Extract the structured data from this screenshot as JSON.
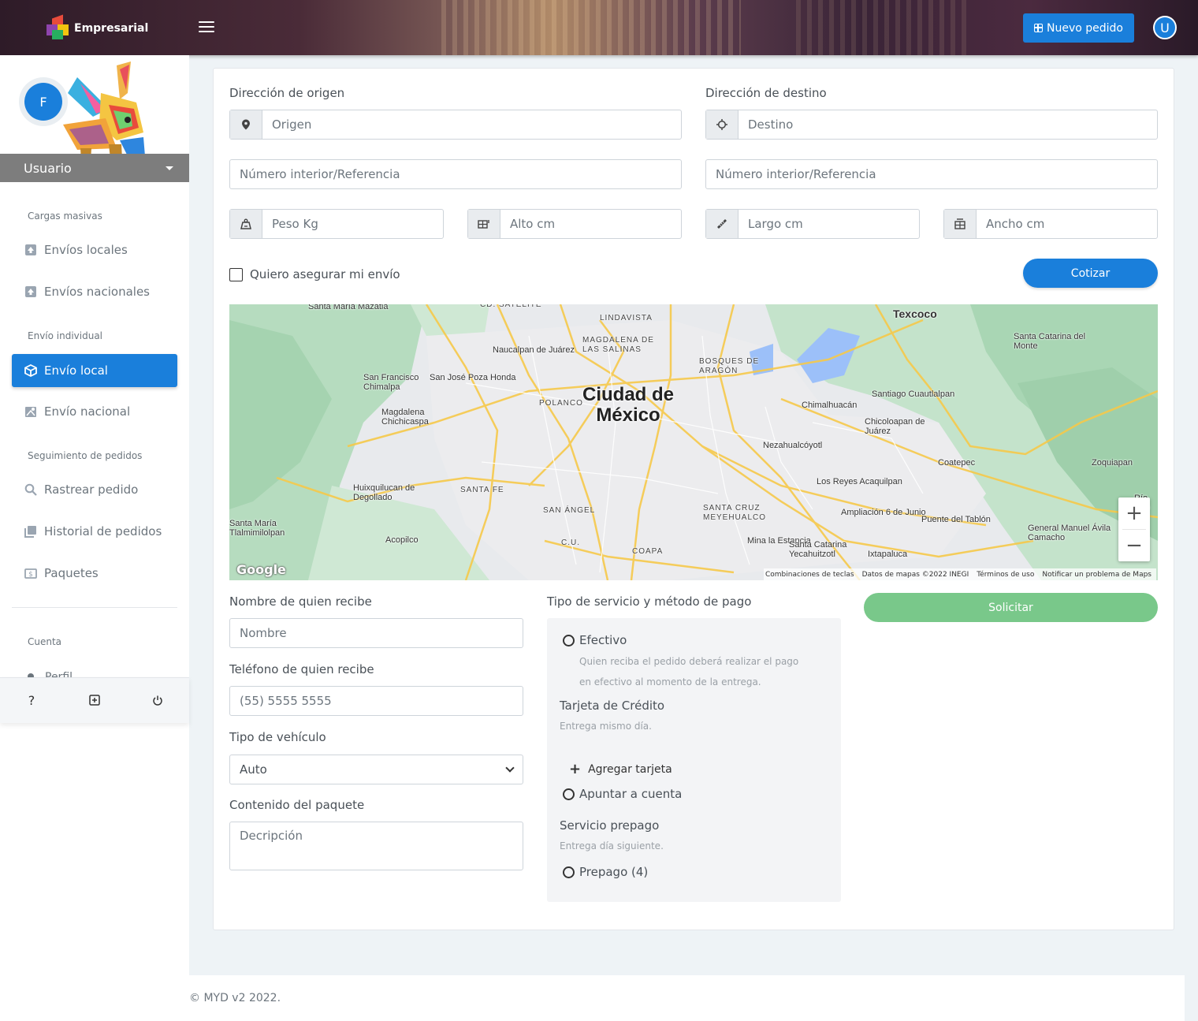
{
  "header": {
    "brand": "Empresarial",
    "new_order_label": "Nuevo pedido",
    "user_initial": "U"
  },
  "sidebar": {
    "avatar_initial": "F",
    "user_label": "Usuario",
    "sections": {
      "bulk": "Cargas masivas",
      "individual": "Envío individual",
      "tracking": "Seguimiento de pedidos",
      "account": "Cuenta"
    },
    "items": {
      "local_bulk": "Envíos locales",
      "national_bulk": "Envíos nacionales",
      "local": "Envío local",
      "national": "Envío nacional",
      "track": "Rastrear pedido",
      "history": "Historial de pedidos",
      "packages": "Paquetes",
      "profile": "Perfil"
    },
    "footer_icons": [
      "help-icon",
      "add-box-icon",
      "power-icon"
    ]
  },
  "form": {
    "origin_label": "Dirección de origen",
    "origin_placeholder": "Origen",
    "destination_label": "Dirección de destino",
    "destination_placeholder": "Destino",
    "interior_placeholder": "Número interior/Referencia",
    "weight_placeholder": "Peso Kg",
    "height_placeholder": "Alto cm",
    "length_placeholder": "Largo cm",
    "width_placeholder": "Ancho cm",
    "insure_label": "Quiero asegurar mi envío",
    "quote_button": "Cotizar",
    "receiver_name_label": "Nombre de quien recibe",
    "receiver_name_placeholder": "Nombre",
    "receiver_phone_label": "Teléfono de quien recibe",
    "receiver_phone_placeholder": "(55) 5555 5555",
    "vehicle_label": "Tipo de vehículo",
    "vehicle_selected": "Auto",
    "content_label": "Contenido del paquete",
    "content_placeholder": "Decripción",
    "request_button": "Solicitar"
  },
  "payment": {
    "title": "Tipo de servicio y método de pago",
    "cash_label": "Efectivo",
    "cash_note_1": "Quien reciba el pedido deberá realizar el pago",
    "cash_note_2": "en efectivo al momento de la entrega.",
    "credit_title": "Tarjeta de Crédito",
    "credit_note": "Entrega mismo día.",
    "add_card": "Agregar tarjeta",
    "account_label": "Apuntar a cuenta",
    "prepaid_title": "Servicio prepago",
    "prepaid_note": "Entrega día siguiente.",
    "prepaid_label": "Prepago (4)"
  },
  "map": {
    "city_line1": "Ciudad de",
    "city_line2": "México",
    "places": [
      "Santa María Mazatla",
      "CD. SATÉLITE",
      "LINDAVISTA",
      "MAGDALENA DE LAS SALINAS",
      "Texcoco",
      "Santa Catarina del Monte",
      "Naucalpan de Juárez",
      "BOSQUES DE ARAGÓN",
      "San José Poza Honda",
      "San Francisco Chimalpa",
      "Magdalena Chichicaspa",
      "POLANCO",
      "Santiago Cuautlalpan",
      "Chimalhuacán",
      "Chicoloapan de Juárez",
      "Nezahualcóyotl",
      "Coatepec",
      "Zoquiapan",
      "Huixquilucan de Degollado",
      "SANTA FE",
      "Los Reyes Acaquilpan",
      "Santa María Tlalmimilolpan",
      "SAN ÁNGEL",
      "SANTA CRUZ MEYEHUALCO",
      "Ampliación 6 de Junio",
      "Puente del Tablón",
      "Acopilco",
      "C.U.",
      "COAPA",
      "Mina la Estancia",
      "Santa Catarina Yecahuitzotl",
      "General Manuel Ávila Camacho",
      "Ixtapaluca",
      "Río Frío"
    ],
    "zoom_in": "+",
    "zoom_out": "−",
    "logo": "Google",
    "attribution": [
      "Combinaciones de teclas",
      "Datos de mapas ©2022 INEGI",
      "Términos de uso",
      "Notificar un problema de Maps"
    ]
  },
  "footer": {
    "copyright": "© MYD v2 2022."
  },
  "colors": {
    "primary": "#1a7fdb",
    "success": "#79c88a",
    "sidebar_user_bar": "#7d7d7d"
  }
}
